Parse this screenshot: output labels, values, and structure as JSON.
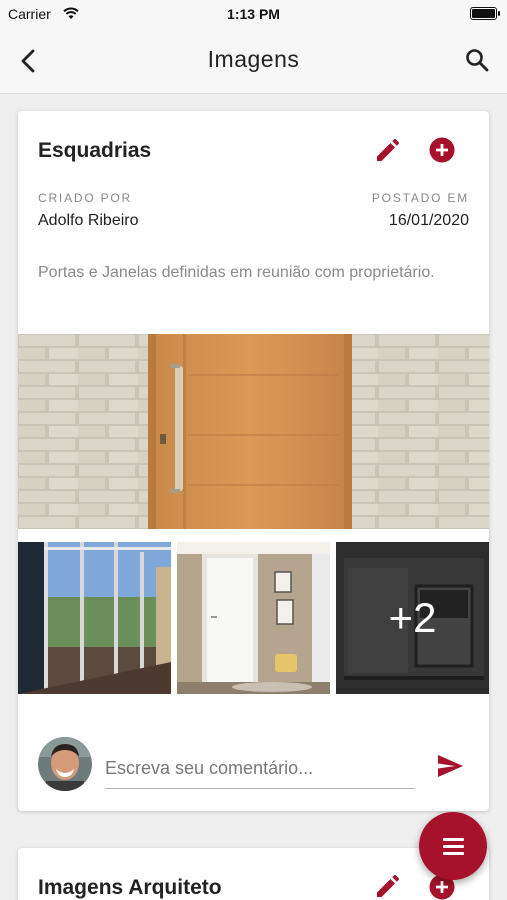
{
  "status_bar": {
    "carrier": "Carrier",
    "time": "1:13 PM"
  },
  "nav": {
    "title": "Imagens",
    "back_icon": "chevron-left-icon",
    "search_icon": "search-icon"
  },
  "colors": {
    "accent": "#a6122b",
    "background": "#efefef",
    "card": "#ffffff"
  },
  "cards": [
    {
      "title": "Esquadrias",
      "created_by_label": "CRIADO POR",
      "created_by": "Adolfo Ribeiro",
      "posted_at_label": "POSTADO EM",
      "posted_at": "16/01/2020",
      "description": "Portas e Janelas definidas em reunião com proprietário.",
      "more_images_label": "+2",
      "comment_placeholder": "Escreva seu comentário..."
    },
    {
      "title": "Imagens Arquiteto"
    }
  ],
  "fab": {
    "icon": "menu-icon"
  }
}
